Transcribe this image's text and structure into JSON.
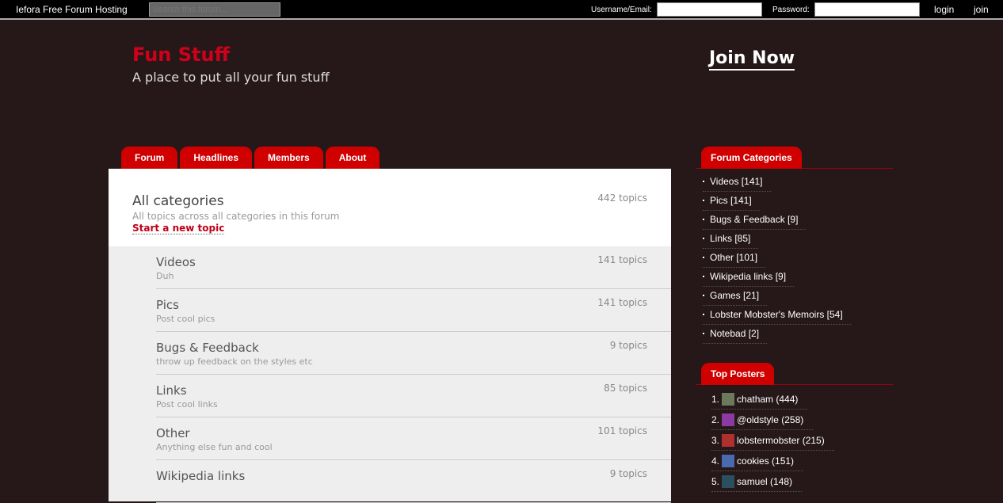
{
  "topbar": {
    "brand": "Iefora Free Forum Hosting",
    "search_placeholder": "Search this forum...",
    "username_label": "Username/Email:",
    "password_label": "Password:",
    "login": "login",
    "join": "join"
  },
  "header": {
    "title": "Fun Stuff",
    "subtitle": "A place to put all your fun stuff",
    "join_now": "Join Now"
  },
  "tabs": [
    "Forum",
    "Headlines",
    "Members",
    "About"
  ],
  "main": {
    "title": "All categories",
    "description": "All topics across all categories in this forum",
    "new_topic": "Start a new topic",
    "count": "442 topics",
    "categories": [
      {
        "name": "Videos",
        "desc": "Duh",
        "count": "141 topics"
      },
      {
        "name": "Pics",
        "desc": "Post cool pics",
        "count": "141 topics"
      },
      {
        "name": "Bugs & Feedback",
        "desc": "throw up feedback on the styles etc",
        "count": "9 topics"
      },
      {
        "name": "Links",
        "desc": "Post cool links",
        "count": "85 topics"
      },
      {
        "name": "Other",
        "desc": "Anything else fun and cool",
        "count": "101 topics"
      },
      {
        "name": "Wikipedia links",
        "desc": "",
        "count": "9 topics"
      }
    ]
  },
  "sidebar": {
    "categories_title": "Forum Categories",
    "categories": [
      "Videos [141]",
      "Pics [141]",
      "Bugs & Feedback [9]",
      "Links [85]",
      "Other [101]",
      "Wikipedia links [9]",
      "Games [21]",
      "Lobster Mobster's Memoirs [54]",
      "Notebad [2]"
    ],
    "posters_title": "Top Posters",
    "posters": [
      {
        "rank": "1.",
        "name": "chatham (444)",
        "color": "#6a7a5a"
      },
      {
        "rank": "2.",
        "name": "@oldstyle (258)",
        "color": "#8a3aa0"
      },
      {
        "rank": "3.",
        "name": "lobstermobster (215)",
        "color": "#b03030"
      },
      {
        "rank": "4.",
        "name": "cookies (151)",
        "color": "#4a6ab0"
      },
      {
        "rank": "5.",
        "name": "samuel (148)",
        "color": "#2a5060"
      }
    ]
  }
}
